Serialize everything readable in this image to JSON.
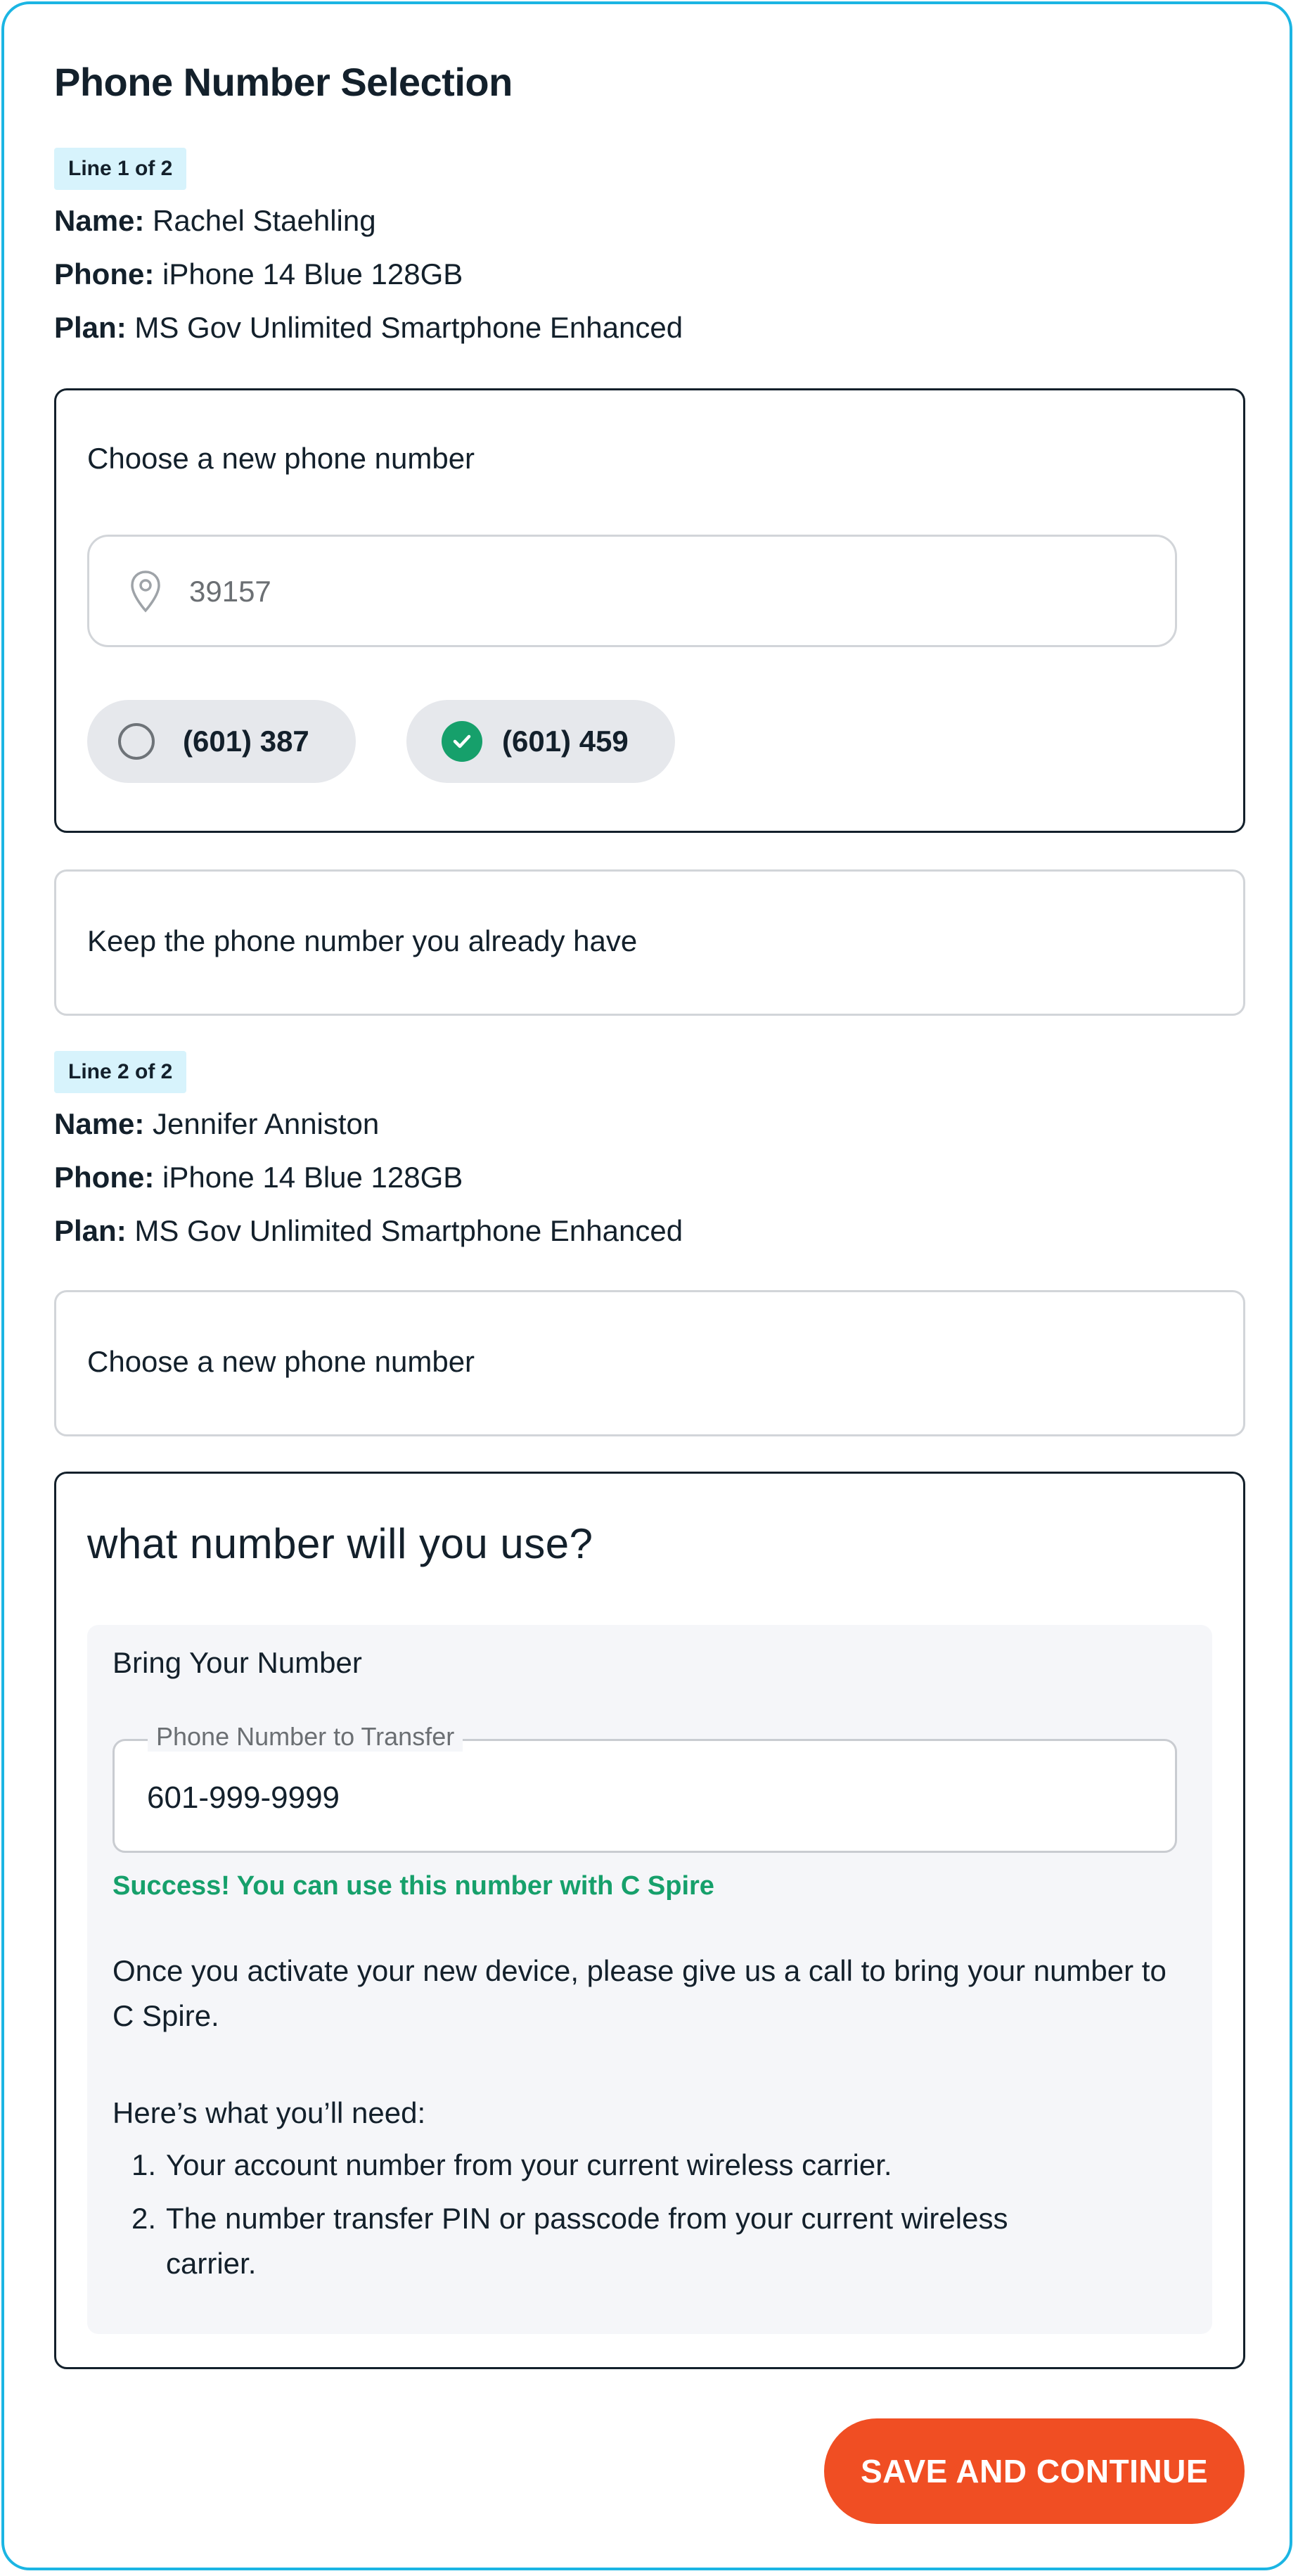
{
  "page": {
    "title": "Phone Number Selection"
  },
  "colors": {
    "frame_border": "#1bb5e3",
    "badge_bg": "#d7f3fc",
    "success_green": "#16a06b",
    "cta_orange": "#f04e23",
    "text_dark": "#13202b"
  },
  "line1": {
    "badge": "Line 1 of 2",
    "name_label": "Name:",
    "name_value": " Rachel Staehling",
    "phone_label": "Phone:",
    "phone_value": " iPhone 14 Blue 128GB",
    "plan_label": "Plan:",
    "plan_value": " MS Gov Unlimited Smartphone Enhanced",
    "choose_new_label": "Choose a new phone number",
    "zip_value": "39157",
    "zip_icon": "location-pin-icon",
    "options": [
      {
        "label": "(601) 387",
        "selected": false
      },
      {
        "label": "(601) 459",
        "selected": true
      }
    ],
    "keep_label": "Keep the phone number you already have"
  },
  "line2": {
    "badge": "Line 2 of 2",
    "name_label": "Name:",
    "name_value": " Jennifer Anniston",
    "phone_label": "Phone:",
    "phone_value": " iPhone 14 Blue 128GB",
    "plan_label": "Plan:",
    "plan_value": " MS Gov Unlimited Smartphone Enhanced",
    "choose_new_label": "Choose a new phone number",
    "question": "what number will you use?",
    "bring_title": "Bring Your Number",
    "transfer_legend": "Phone Number to Transfer",
    "transfer_value": "601-999-9999",
    "success": "Success! You can use this number with C Spire",
    "activate_text": "Once you activate your new device, please give us a call to bring your number to C Spire.",
    "need_heading": "Here’s what you’ll need:",
    "needs": [
      {
        "num": "1.",
        "text": "Your account number from your current wireless carrier."
      },
      {
        "num": "2.",
        "text": "The number transfer PIN or passcode from your current wireless carrier."
      }
    ]
  },
  "footer": {
    "save_label": "SAVE AND CONTINUE"
  }
}
